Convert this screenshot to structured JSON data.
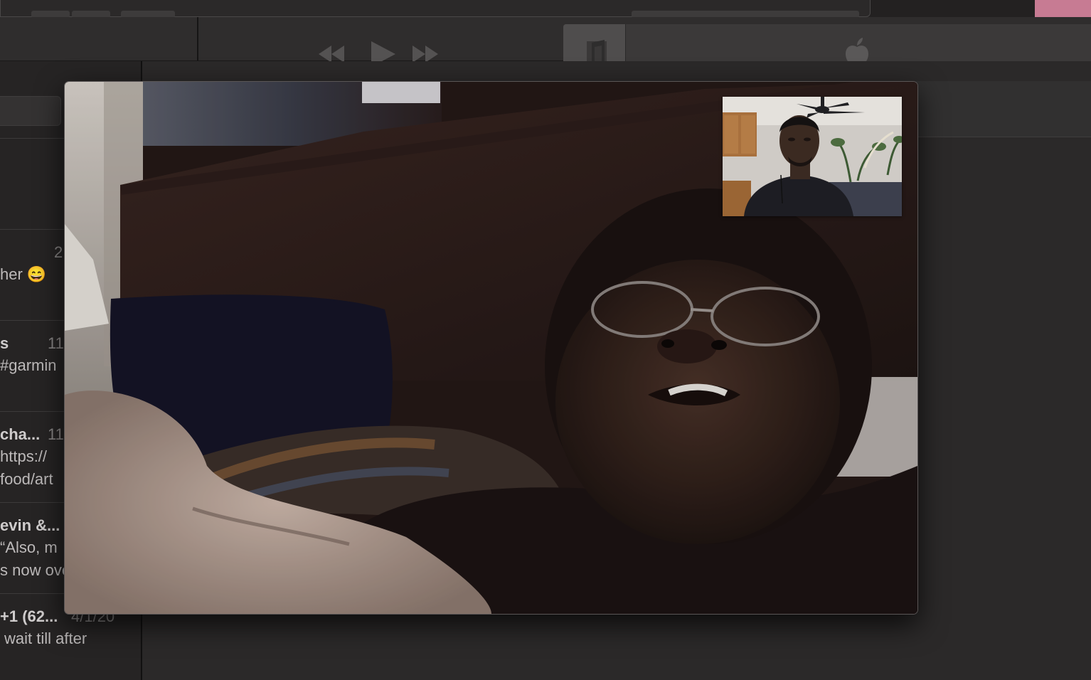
{
  "conversations": [
    {
      "name": "",
      "date": "2",
      "preview": [
        "her 😄"
      ]
    },
    {
      "name": "s",
      "date": "11",
      "preview": [
        "#garmin"
      ]
    },
    {
      "name": "cha...",
      "date": "11",
      "preview": [
        "https://",
        "food/art"
      ]
    },
    {
      "name": "evin &...",
      "date": "",
      "preview": [
        "“Also, m",
        "s now ove"
      ]
    },
    {
      "name": "+1 (62...",
      "date": "4/1/20",
      "preview": [
        "wait till after"
      ]
    }
  ],
  "player": {
    "transport_icons": [
      "rewind-icon",
      "play-icon",
      "fast-forward-icon"
    ],
    "lcd_icons": [
      "music-note-icon",
      "apple-logo-icon"
    ]
  },
  "facetime": {
    "remote_video": "remote-video-feed",
    "self_view": "self-view-thumbnail"
  },
  "colors": {
    "window_bg": "#2a2828",
    "sidebar_bg": "#262424",
    "text": "#bdbaba"
  }
}
